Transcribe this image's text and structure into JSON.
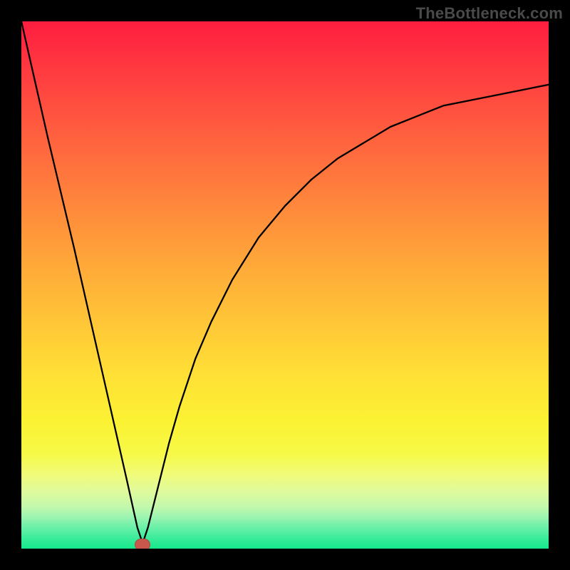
{
  "watermark": "TheBottleneck.com",
  "chart_data": {
    "type": "line",
    "title": "",
    "xlabel": "",
    "ylabel": "",
    "xlim": [
      0,
      100
    ],
    "ylim": [
      0,
      100
    ],
    "grid": false,
    "legend": false,
    "notes": "Background is a vertical rainbow gradient (red top → green bottom). One black curve with a sharp V-shaped notch near x≈23 reaching y≈0, rising steeply on both sides; right side asymptotically rises toward ~88 at x=100. A small red rounded marker sits at the notch minimum.",
    "series": [
      {
        "name": "curve",
        "x": [
          0,
          5,
          10,
          15,
          20,
          22,
          23,
          24,
          26,
          28,
          30,
          33,
          36,
          40,
          45,
          50,
          55,
          60,
          65,
          70,
          75,
          80,
          85,
          90,
          95,
          100
        ],
        "y": [
          100,
          78,
          57,
          35,
          13,
          4,
          1,
          4,
          12,
          20,
          27,
          36,
          43,
          51,
          59,
          65,
          70,
          74,
          77,
          80,
          82,
          84,
          85,
          86,
          87,
          88
        ]
      }
    ],
    "marker": {
      "x": 23,
      "y": 0.5
    },
    "colors": {
      "curve": "#000000",
      "marker": "#c9574b",
      "frame": "#000000",
      "gradient_top": "#ff1d3f",
      "gradient_bottom": "#15e98d"
    }
  }
}
